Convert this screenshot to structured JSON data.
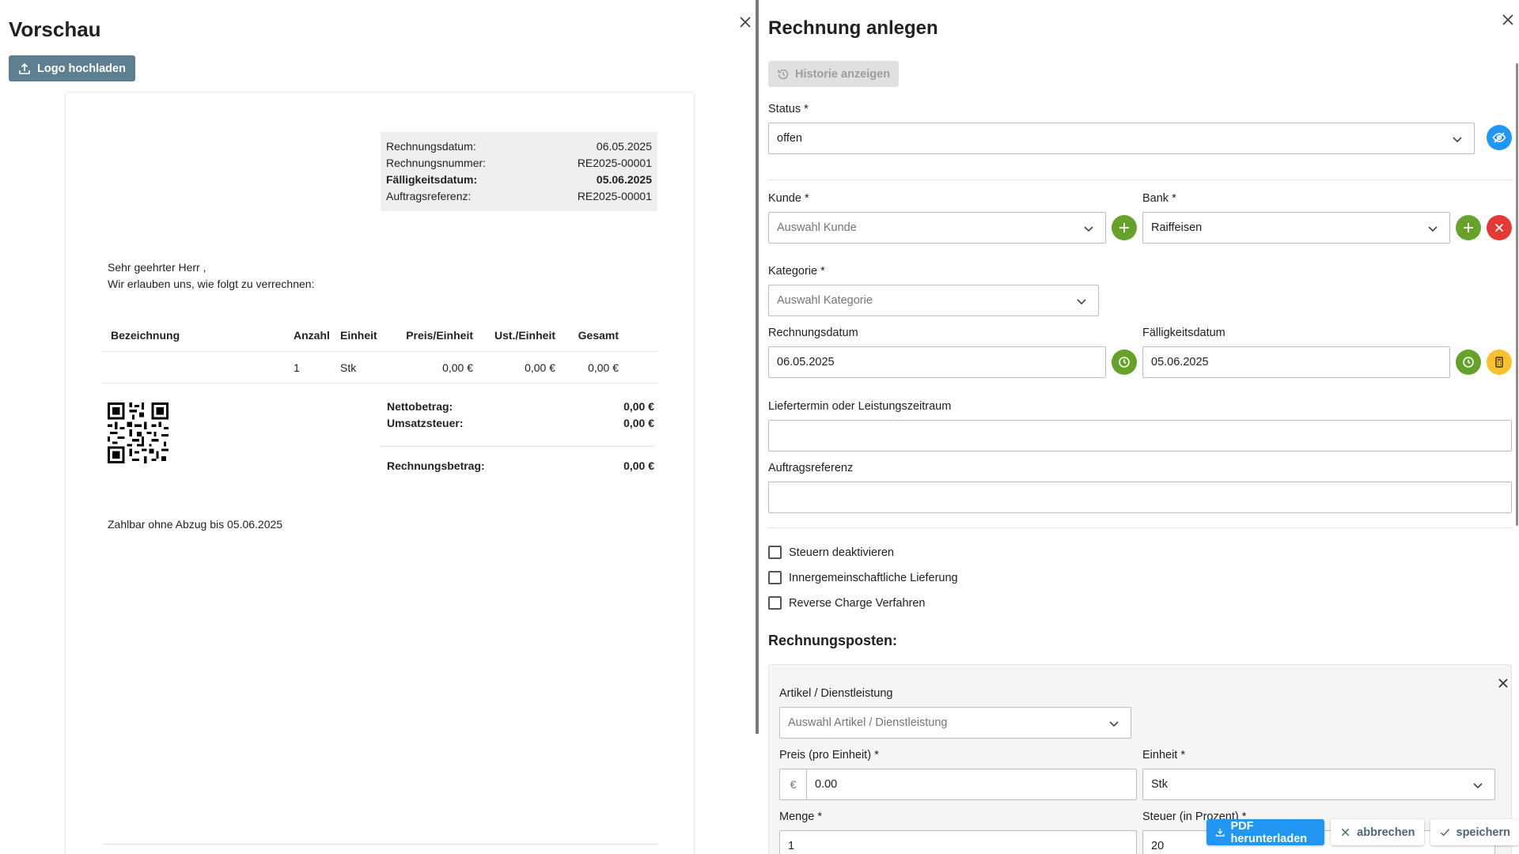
{
  "preview": {
    "title": "Vorschau",
    "logo_button": "Logo hochladen",
    "meta": [
      {
        "label": "Rechnungsdatum:",
        "value": "06.05.2025",
        "bold": false
      },
      {
        "label": "Rechnungsnummer:",
        "value": "RE2025-00001",
        "bold": false
      },
      {
        "label": "Fälligkeitsdatum:",
        "value": "05.06.2025",
        "bold": true
      },
      {
        "label": "Auftragsreferenz:",
        "value": "RE2025-00001",
        "bold": false
      }
    ],
    "greeting_line1": "Sehr geehrter Herr ,",
    "greeting_line2": "Wir erlauben uns, wie folgt zu verrechnen:",
    "table": {
      "headers": [
        "Bezeichnung",
        "Anzahl",
        "Einheit",
        "Preis/Einheit",
        "Ust./Einheit",
        "Gesamt"
      ],
      "rows": [
        [
          "",
          "1",
          "Stk",
          "0,00 €",
          "0,00 €",
          "0,00 €"
        ]
      ]
    },
    "totals": {
      "net_label": "Nettobetrag:",
      "net_value": "0,00 €",
      "tax_label": "Umsatzsteuer:",
      "tax_value": "0,00 €",
      "gross_label": "Rechnungsbetrag:",
      "gross_value": "0,00 €"
    },
    "payable_text": "Zahlbar ohne Abzug bis 05.06.2025"
  },
  "form": {
    "title": "Rechnung anlegen",
    "history_button": "Historie anzeigen",
    "status_label": "Status *",
    "status_value": "offen",
    "kunde_label": "Kunde *",
    "kunde_placeholder": "Auswahl Kunde",
    "bank_label": "Bank *",
    "bank_value": "Raiffeisen",
    "kategorie_label": "Kategorie *",
    "kategorie_placeholder": "Auswahl Kategorie",
    "rechnungsdatum_label": "Rechnungsdatum",
    "rechnungsdatum_value": "06.05.2025",
    "faelligkeit_label": "Fälligkeitsdatum",
    "faelligkeit_value": "05.06.2025",
    "liefertermin_label": "Liefertermin oder Leistungszeitraum",
    "liefertermin_value": "",
    "auftragsreferenz_label": "Auftragsreferenz",
    "auftragsreferenz_value": "",
    "checkboxes": [
      "Steuern deaktivieren",
      "Innergemeinschaftliche Lieferung",
      "Reverse Charge Verfahren"
    ],
    "posten_title": "Rechnungsposten:",
    "posten": {
      "artikel_label": "Artikel / Dienstleistung",
      "artikel_placeholder": "Auswahl Artikel / Dienstleistung",
      "preis_label": "Preis (pro Einheit) *",
      "preis_prefix": "€",
      "preis_value": "0.00",
      "einheit_label": "Einheit *",
      "einheit_value": "Stk",
      "menge_label": "Menge *",
      "menge_value": "1",
      "steuer_label": "Steuer (in Prozent) *",
      "steuer_value": "20"
    },
    "actions": {
      "pdf": "PDF herunterladen",
      "cancel": "abbrechen",
      "save": "speichern"
    }
  },
  "colors": {
    "green": "#66a229",
    "red": "#e53935",
    "blue": "#2196f3",
    "amber": "#fbc02d",
    "slate": "#5e7f8f"
  }
}
